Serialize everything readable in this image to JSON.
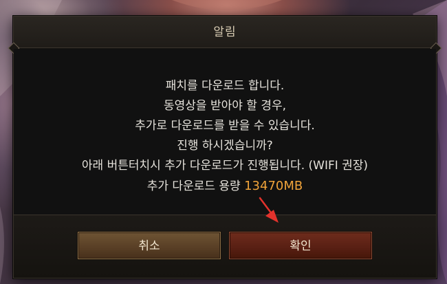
{
  "dialog": {
    "title": "알림",
    "message_lines": [
      "패치를 다운로드 합니다.",
      "동영상을 받아야 할 경우,",
      "추가로 다운로드를 받을 수 있습니다.",
      "진행 하시겠습니까?",
      "아래 버튼터치시 추가 다운로드가 진행됩니다. (WIFI 권장)"
    ],
    "size_label": "추가 다운로드 용량",
    "size_value": "13470MB",
    "cancel_label": "취소",
    "confirm_label": "확인"
  },
  "colors": {
    "size_value": "#f0a33a",
    "annotation_arrow": "#e3322c",
    "cancel_button": "#5a4026",
    "confirm_button": "#5a2014"
  },
  "annotation": {
    "icon": "red-arrow-pointing-to-confirm"
  }
}
